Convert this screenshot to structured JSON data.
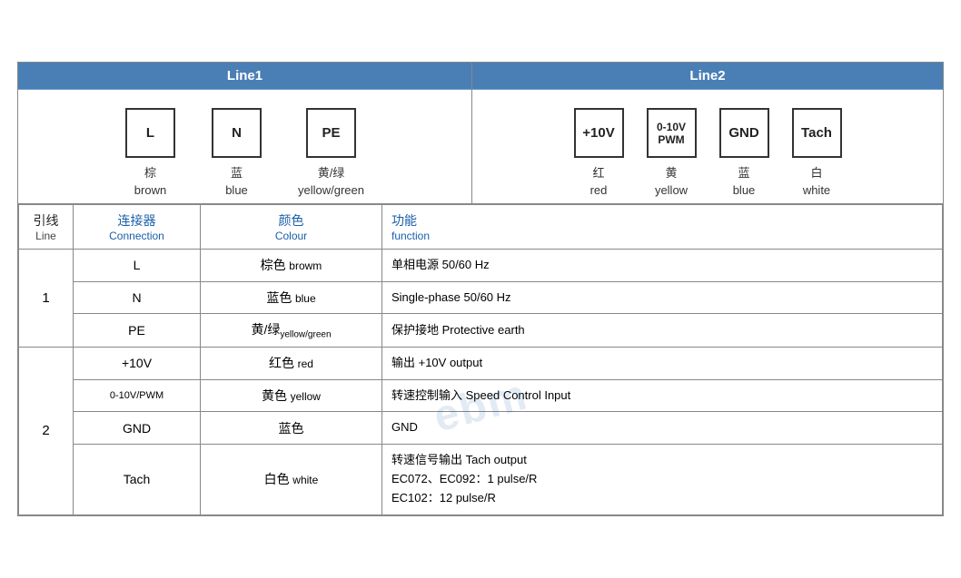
{
  "header": {
    "line1_label": "Line1",
    "line2_label": "Line2"
  },
  "line1_connectors": [
    {
      "id": "L",
      "label_cn": "棕",
      "label_en": "brown"
    },
    {
      "id": "N",
      "label_cn": "蓝",
      "label_en": "blue"
    },
    {
      "id": "PE",
      "label_cn": "黄/绿",
      "label_en": "yellow/green"
    }
  ],
  "line2_connectors": [
    {
      "id": "+10V",
      "label_cn": "红",
      "label_en": "red"
    },
    {
      "id": "0-10V\nPWM",
      "label_cn": "黄",
      "label_en": "yellow"
    },
    {
      "id": "GND",
      "label_cn": "蓝",
      "label_en": "blue"
    },
    {
      "id": "Tach",
      "label_cn": "白",
      "label_en": "white"
    }
  ],
  "table_headers": {
    "line_cn": "引线",
    "line_en": "Line",
    "connection_cn": "连接器",
    "connection_en": "Connection",
    "colour_cn": "颜色",
    "colour_en": "Colour",
    "function_cn": "功能",
    "function_en": "function"
  },
  "table_rows": [
    {
      "line": "1",
      "entries": [
        {
          "connection": "L",
          "colour_cn": "棕色",
          "colour_en": "browm",
          "function": "单相电源 50/60 Hz"
        },
        {
          "connection": "N",
          "colour_cn": "蓝色",
          "colour_en": "blue",
          "function": "Single-phase 50/60 Hz"
        },
        {
          "connection": "PE",
          "colour_cn": "黄/绿",
          "colour_en": "yellow/green",
          "function": "保护接地 Protective earth"
        }
      ]
    },
    {
      "line": "2",
      "entries": [
        {
          "connection": "+10V",
          "colour_cn": "红色",
          "colour_en": "red",
          "function": "输出 +10V output"
        },
        {
          "connection": "0-10V/PWM",
          "colour_cn": "黄色",
          "colour_en": "yellow",
          "function": "转速控制输入 Speed Control Input"
        },
        {
          "connection": "GND",
          "colour_cn": "蓝色",
          "colour_en": "",
          "function": "GND"
        },
        {
          "connection": "Tach",
          "colour_cn": "白色",
          "colour_en": "white",
          "function": "转速信号输出 Tach output\nEC072、EC092：1 pulse/R\nEC102：12 pulse/R"
        }
      ]
    }
  ]
}
